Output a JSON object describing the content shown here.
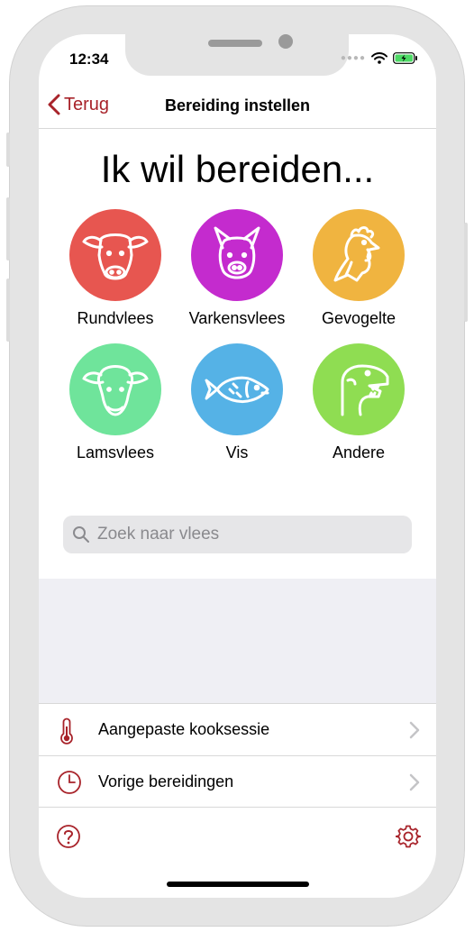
{
  "status": {
    "time": "12:34"
  },
  "nav": {
    "back_label": "Terug",
    "title": "Bereiding instellen"
  },
  "headline": "Ik wil bereiden...",
  "categories": [
    {
      "label": "Rundvlees",
      "color": "#e75650",
      "icon": "cow-icon"
    },
    {
      "label": "Varkensvlees",
      "color": "#c42bce",
      "icon": "pig-icon"
    },
    {
      "label": "Gevogelte",
      "color": "#f0b440",
      "icon": "chicken-icon"
    },
    {
      "label": "Lamsvlees",
      "color": "#6fe49b",
      "icon": "sheep-icon"
    },
    {
      "label": "Vis",
      "color": "#55b2e6",
      "icon": "fish-icon"
    },
    {
      "label": "Andere",
      "color": "#8fdd52",
      "icon": "dinosaur-icon"
    }
  ],
  "search": {
    "placeholder": "Zoek naar vlees"
  },
  "menu": [
    {
      "label": "Aangepaste kooksessie",
      "icon": "thermometer-icon"
    },
    {
      "label": "Vorige bereidingen",
      "icon": "clock-icon"
    }
  ],
  "colors": {
    "accent": "#a8232a",
    "battery": "#4cd964"
  }
}
